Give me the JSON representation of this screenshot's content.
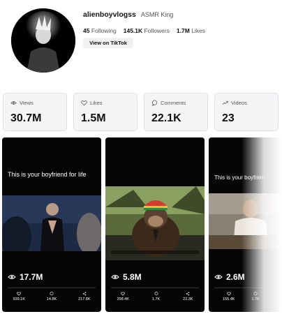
{
  "profile": {
    "username": "alienboyvlogss",
    "nickname": "ASMR King",
    "following_count": "45",
    "following_label": "Following",
    "followers_count": "145.1K",
    "followers_label": "Followers",
    "likes_count": "1.7M",
    "likes_label": "Likes",
    "view_button": "View on TikTok"
  },
  "stats": [
    {
      "label": "Views",
      "value": "30.7M",
      "icon": "eye-icon"
    },
    {
      "label": "Likes",
      "value": "1.5M",
      "icon": "heart-icon"
    },
    {
      "label": "Comments",
      "value": "22.1K",
      "icon": "comment-icon"
    },
    {
      "label": "Videos",
      "value": "23",
      "icon": "trend-icon"
    }
  ],
  "videos": [
    {
      "caption": "This is your boyfriend for life",
      "views": "17.7M",
      "likes": "939.1K",
      "comments": "14.8K",
      "shares": "217.8K"
    },
    {
      "caption": "",
      "views": "5.8M",
      "likes": "298.4K",
      "comments": "1.7K",
      "shares": "22.3K"
    },
    {
      "caption": "This is your boyfrien",
      "views": "2.6M",
      "likes": "155.4K",
      "comments": "1.7K",
      "shares": ""
    }
  ],
  "colors": {
    "tile_bg": "#050505",
    "card_bg": "#f5f5f7",
    "card_border": "#e2e2e6"
  }
}
